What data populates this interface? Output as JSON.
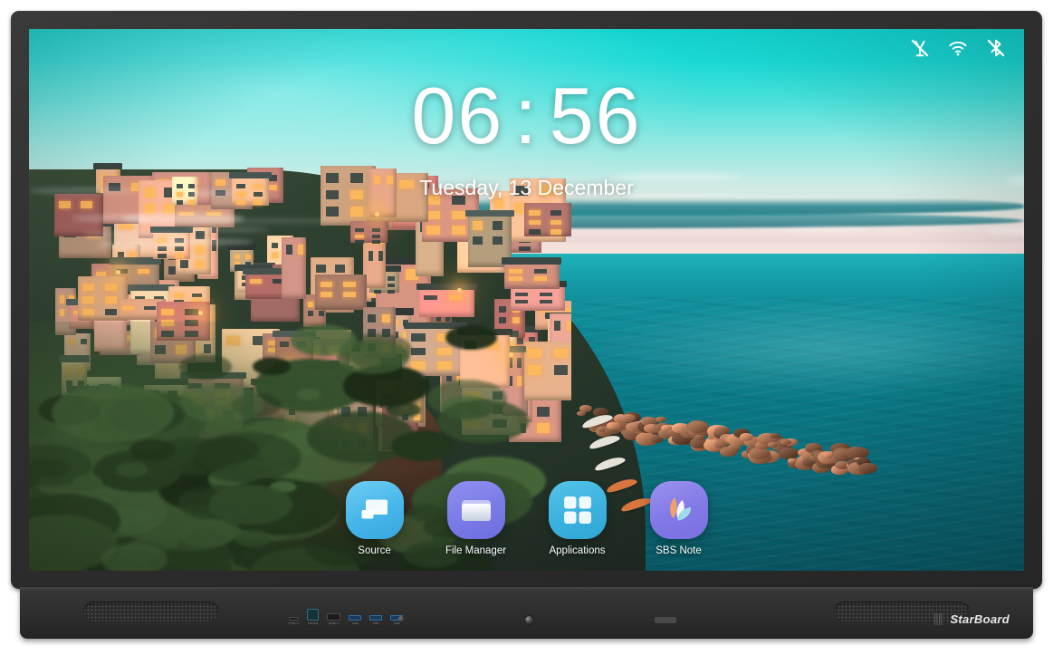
{
  "device": {
    "brand": "StarBoard",
    "ports": [
      {
        "name": "type-c-port",
        "label": "TYPE-C"
      },
      {
        "name": "touch-port",
        "label": "TOUCH"
      },
      {
        "name": "hdmi-port",
        "label": "HDMI 1"
      },
      {
        "name": "usb-port-1",
        "label": "USB"
      },
      {
        "name": "usb-port-2",
        "label": "USB"
      },
      {
        "name": "usb-port-3",
        "label": "USB"
      }
    ]
  },
  "statusbar": {
    "icons": [
      {
        "name": "wireless-projection-off-icon",
        "label": "Wireless projection off"
      },
      {
        "name": "wifi-icon",
        "label": "Wi-Fi connected"
      },
      {
        "name": "bluetooth-off-icon",
        "label": "Bluetooth off"
      }
    ]
  },
  "clock": {
    "hours": "06",
    "separator": ":",
    "minutes": "56",
    "date": "Tuesday, 13 December"
  },
  "dock": {
    "items": [
      {
        "name": "source",
        "label": "Source",
        "icon": "display-cast-icon"
      },
      {
        "name": "file-manager",
        "label": "File Manager",
        "icon": "folder-icon"
      },
      {
        "name": "applications",
        "label": "Applications",
        "icon": "grid-apps-icon"
      },
      {
        "name": "sbs-note",
        "label": "SBS Note",
        "icon": "sbs-note-petal-icon"
      }
    ]
  },
  "colors": {
    "sky_top": "#13d6d2",
    "sky_horizon": "#f3d9d6",
    "sea": "#0a7683",
    "bezel": "#2e2e2e",
    "icon_source": "#45b6ea",
    "icon_files": "#7a7ae8",
    "icon_apps": "#3bb2de",
    "icon_note": "#8278e6"
  }
}
